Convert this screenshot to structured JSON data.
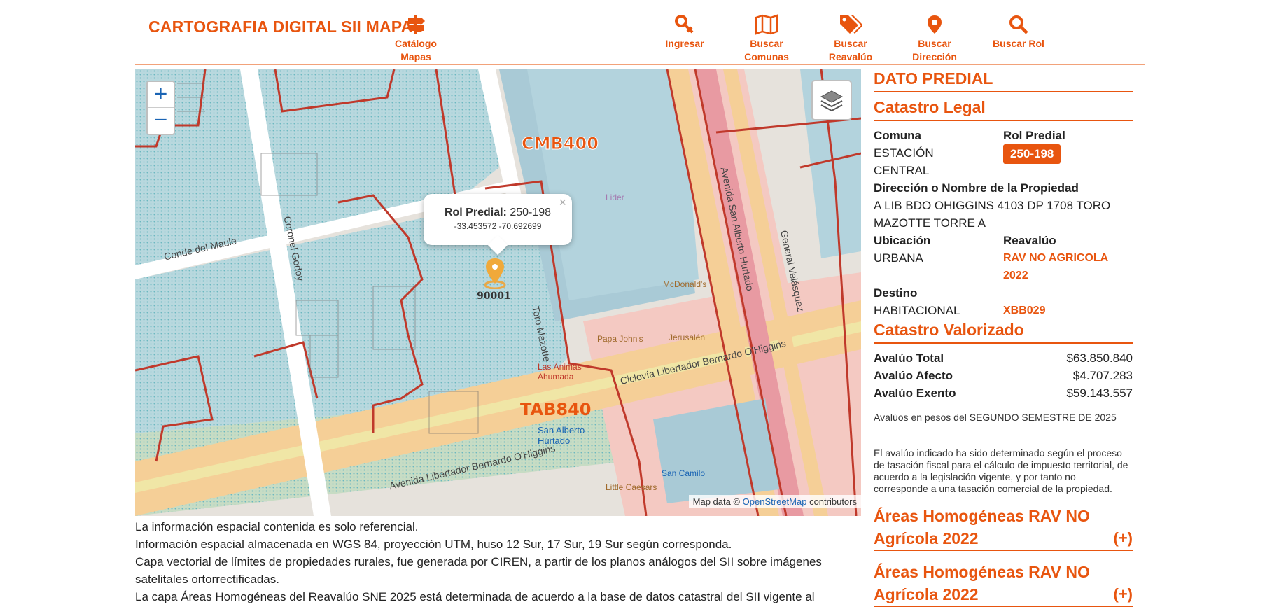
{
  "header": {
    "title": "CARTOGRAFIA DIGITAL SII MAPAS",
    "nav": [
      {
        "line1": "Catálogo",
        "line2": "Mapas",
        "icon": "signpost-icon"
      },
      {
        "line1": "Ingresar",
        "line2": "",
        "icon": "key-icon"
      },
      {
        "line1": "Buscar",
        "line2": "Comunas",
        "icon": "map-icon"
      },
      {
        "line1": "Buscar",
        "line2": "Reavalúo",
        "icon": "tags-icon"
      },
      {
        "line1": "Buscar",
        "line2": "Dirección",
        "icon": "location-pin-icon"
      },
      {
        "line1": "Buscar Rol",
        "line2": "",
        "icon": "search-icon"
      }
    ]
  },
  "map": {
    "zoom_in": "+",
    "zoom_out": "−",
    "labels": {
      "zone1": "CMB400",
      "zone2": "TAB840",
      "block_main": "90001",
      "street1": "Conde del Maule",
      "street2": "Coronel Godoy",
      "street3": "Avenida Libertador Bernardo O'Higgins",
      "street4": "Ciclovía Libertador Bernardo O'Higgins",
      "street5": "Avenida San Alberto Hurtado",
      "street6": "General Velásquez",
      "street7": "Toro Mazotte",
      "poi1": "Lider",
      "poi2": "McDonald's",
      "poi3": "Papa John's",
      "poi4": "Jerusalén",
      "poi5": "San Alberto Hurtado",
      "poi6": "San Camilo",
      "poi7": "Little Caesars",
      "poi8": "Las Ánimas Ahumada"
    },
    "popup": {
      "label": "Rol Predial:",
      "value": "250-198",
      "coords": "-33.453572   -70.692699",
      "close": "×"
    },
    "attribution": {
      "prefix": "Map data © ",
      "link": "OpenStreetMap",
      "suffix": " contributors"
    }
  },
  "notes": [
    "La información espacial contenida es solo referencial.",
    "Información espacial almacenada en WGS 84, proyección UTM, huso 12 Sur, 17 Sur, 19 Sur según corresponda.",
    "Capa vectorial de límites de propiedades rurales, fue generada por CIREN, a partir de los planos análogos del SII sobre imágenes satelitales ortorrectificadas.",
    "La capa Áreas Homogéneas del Reavalúo SNE 2025 está determinada de acuerdo a la base de datos catastral del SII vigente al"
  ],
  "panel": {
    "title": "DATO PREDIAL",
    "legal_title": "Catastro Legal",
    "comuna_label": "Comuna",
    "comuna_value": "ESTACIÓN CENTRAL",
    "rol_label": "Rol Predial",
    "rol_value": "250-198",
    "direccion_label": "Dirección o Nombre de la Propiedad",
    "direccion_value": "A LIB BDO OHIGGINS 4103 DP 1708 TORO MAZOTTE TORRE A",
    "ubicacion_label": "Ubicación",
    "ubicacion_value": "URBANA",
    "reavaluo_label": "Reavalúo",
    "reavaluo_value": "RAV NO AGRICOLA 2022",
    "destino_label": "Destino",
    "destino_value": "HABITACIONAL",
    "destino_code": "XBB029",
    "valorizado_title": "Catastro Valorizado",
    "avaluo_total_label": "Avalúo Total",
    "avaluo_total_value": "$63.850.840",
    "avaluo_afecto_label": "Avalúo Afecto",
    "avaluo_afecto_value": "$4.707.283",
    "avaluo_exento_label": "Avalúo Exento",
    "avaluo_exento_value": "$59.143.557",
    "note1": "Avalúos en pesos del SEGUNDO SEMESTRE DE 2025",
    "note2": "El avalúo indicado ha sido determinado según el proceso de tasación fiscal para el cálculo de impuesto territorial, de acuerdo a la legislación vigente, y por tanto no corresponde a una tasación comercial de la propiedad.",
    "areas1": "Áreas Homogéneas RAV NO Agrícola 2022",
    "areas2": "Áreas Homogéneas RAV NO Agrícola 2022",
    "plus": "(+)"
  },
  "colors": {
    "accent": "#e8550f",
    "parcel_fill": "#b6d6dc",
    "parcel_border": "#c0392b",
    "road": "#ffffff",
    "commercial": "#f5c7c0",
    "avenue": "#f7d39a",
    "link": "#1a64b4"
  }
}
